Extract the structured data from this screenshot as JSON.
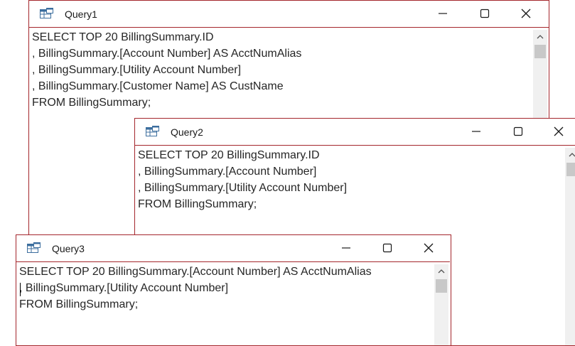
{
  "windows": [
    {
      "title": "Query1",
      "sql_lines": [
        "SELECT TOP 20 BillingSummary.ID",
        ", BillingSummary.[Account Number] AS AcctNumAlias",
        ", BillingSummary.[Utility Account Number]",
        ", BillingSummary.[Customer Name] AS CustName",
        "FROM BillingSummary;"
      ]
    },
    {
      "title": "Query2",
      "sql_lines": [
        "SELECT TOP 20 BillingSummary.ID",
        ", BillingSummary.[Account Number]",
        ", BillingSummary.[Utility Account Number]",
        "FROM BillingSummary;"
      ]
    },
    {
      "title": "Query3",
      "sql_lines": [
        "SELECT TOP 20 BillingSummary.[Account Number] AS AcctNumAlias",
        ", BillingSummary.[Utility Account Number]",
        "FROM BillingSummary;"
      ]
    }
  ],
  "icons": {
    "query": "query-datasheet-icon",
    "minimize": "minimize-icon",
    "maximize": "maximize-icon",
    "close": "close-icon",
    "scroll_up": "chevron-up-icon"
  },
  "colors": {
    "window_border": "#a4262c",
    "text": "#262626",
    "scroll_track": "#f0f0f0",
    "scroll_thumb": "#c8c8c8"
  }
}
